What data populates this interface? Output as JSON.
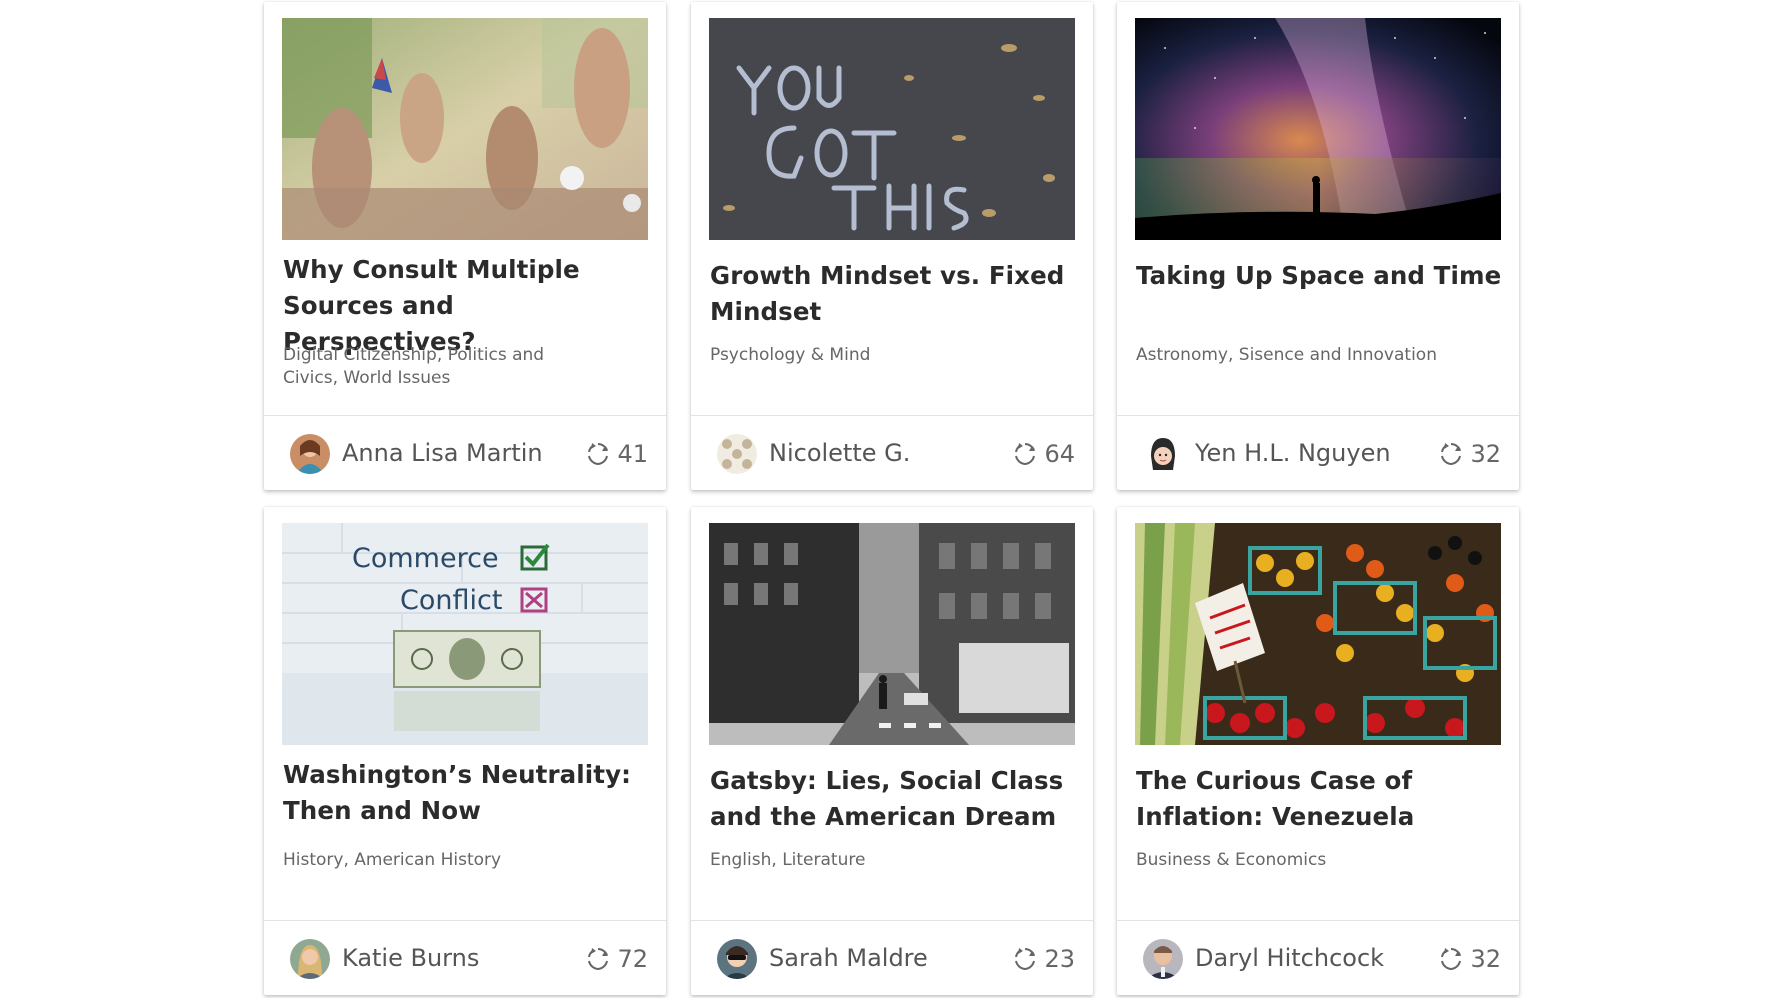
{
  "cards": [
    {
      "title": "Why Consult Multiple Sources and Perspectives?",
      "tags": "Digital Citizenship, Politics and Civics, World Issues",
      "author": "Anna Lisa Martin",
      "remix_count": "41",
      "image": "crowd-raised-hands-photo",
      "avatar": "woman-avatar-photo"
    },
    {
      "title": "Growth Mindset vs. Fixed Mindset",
      "tags": "Psychology & Mind",
      "author": "Nicolette G.",
      "remix_count": "64",
      "image": "chalk-you-got-this-photo",
      "avatar": "pattern-avatar"
    },
    {
      "title": "Taking Up Space and Time",
      "tags": "Astronomy, Sisence and Innovation",
      "author": "Yen H.L. Nguyen",
      "remix_count": "32",
      "image": "milky-way-silhouette-photo",
      "avatar": "cartoon-girl-avatar"
    },
    {
      "title": "Washington’s Neutrality: Then and Now",
      "tags": "History, American History",
      "author": "Katie Burns",
      "remix_count": "72",
      "image": "commerce-conflict-dollar-photo",
      "image_text": {
        "line1": "Commerce",
        "line2": "Conflict"
      },
      "avatar": "woman-blonde-avatar-photo"
    },
    {
      "title": "Gatsby: Lies, Social Class and the American Dream",
      "tags": "English, Literature",
      "author": "Sarah Maldre",
      "remix_count": "23",
      "image": "city-street-black-white-photo",
      "avatar": "sunglasses-avatar"
    },
    {
      "title": "The Curious Case of Inflation: Venezuela",
      "tags": "Business & Economics",
      "author": "Daryl Hitchcock",
      "remix_count": "32",
      "image": "farmers-market-produce-photo",
      "avatar": "man-avatar-photo"
    }
  ]
}
